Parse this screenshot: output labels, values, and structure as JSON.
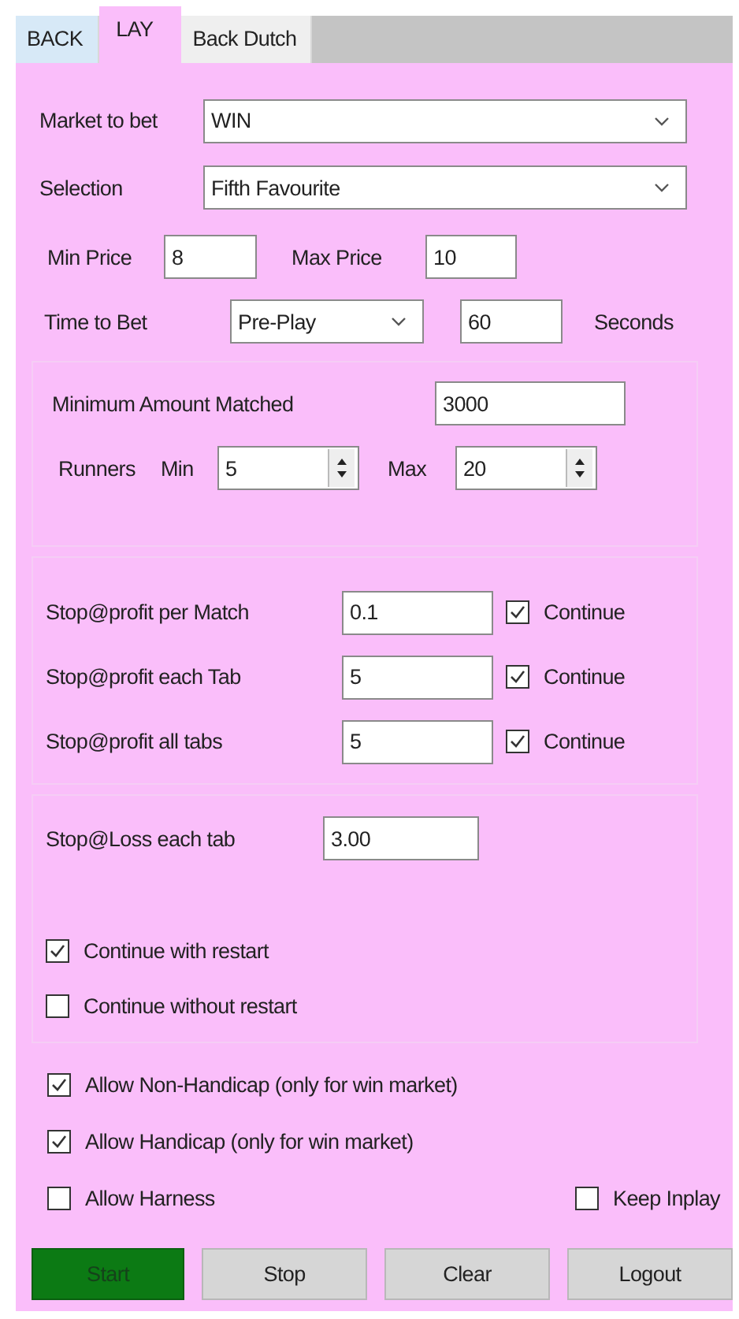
{
  "tabs": [
    {
      "label": "BACK",
      "selected": false
    },
    {
      "label": "LAY",
      "selected": true
    },
    {
      "label": "Back Dutch",
      "selected": false
    }
  ],
  "market": {
    "label": "Market to bet",
    "value": "WIN"
  },
  "selection": {
    "label": "Selection",
    "value": "Fifth Favourite"
  },
  "price": {
    "min_label": "Min Price",
    "min": "8",
    "max_label": "Max Price",
    "max": "10"
  },
  "time": {
    "label": "Time to Bet",
    "mode": "Pre-Play",
    "value": "60",
    "unit": "Seconds"
  },
  "liquidity": {
    "label": "Minimum Amount Matched",
    "value": "3000"
  },
  "runners": {
    "label": "Runners",
    "min_label": "Min",
    "min": "5",
    "max_label": "Max",
    "max": "20"
  },
  "stop_profit": [
    {
      "label": "Stop@profit per Match",
      "value": "0.1",
      "continue_label": "Continue",
      "checked": true
    },
    {
      "label": "Stop@profit each Tab",
      "value": "5",
      "continue_label": "Continue",
      "checked": true
    },
    {
      "label": "Stop@profit all tabs",
      "value": "5",
      "continue_label": "Continue",
      "checked": true
    }
  ],
  "stop_loss": {
    "label": "Stop@Loss each tab",
    "value": "3.00"
  },
  "restart_options": [
    {
      "label": "Continue with restart",
      "checked": true
    },
    {
      "label": "Continue without restart",
      "checked": false
    }
  ],
  "filters": [
    {
      "label": "Allow Non-Handicap (only for win market)",
      "checked": true
    },
    {
      "label": "Allow Handicap (only for win market)",
      "checked": true
    },
    {
      "label": "Allow Harness",
      "checked": false
    }
  ],
  "keep_inplay": {
    "label": "Keep Inplay",
    "checked": false
  },
  "buttons": [
    {
      "label": "Start",
      "kind": "go"
    },
    {
      "label": "Stop",
      "kind": "normal"
    },
    {
      "label": "Clear",
      "kind": "normal"
    },
    {
      "label": "Logout",
      "kind": "normal"
    }
  ]
}
